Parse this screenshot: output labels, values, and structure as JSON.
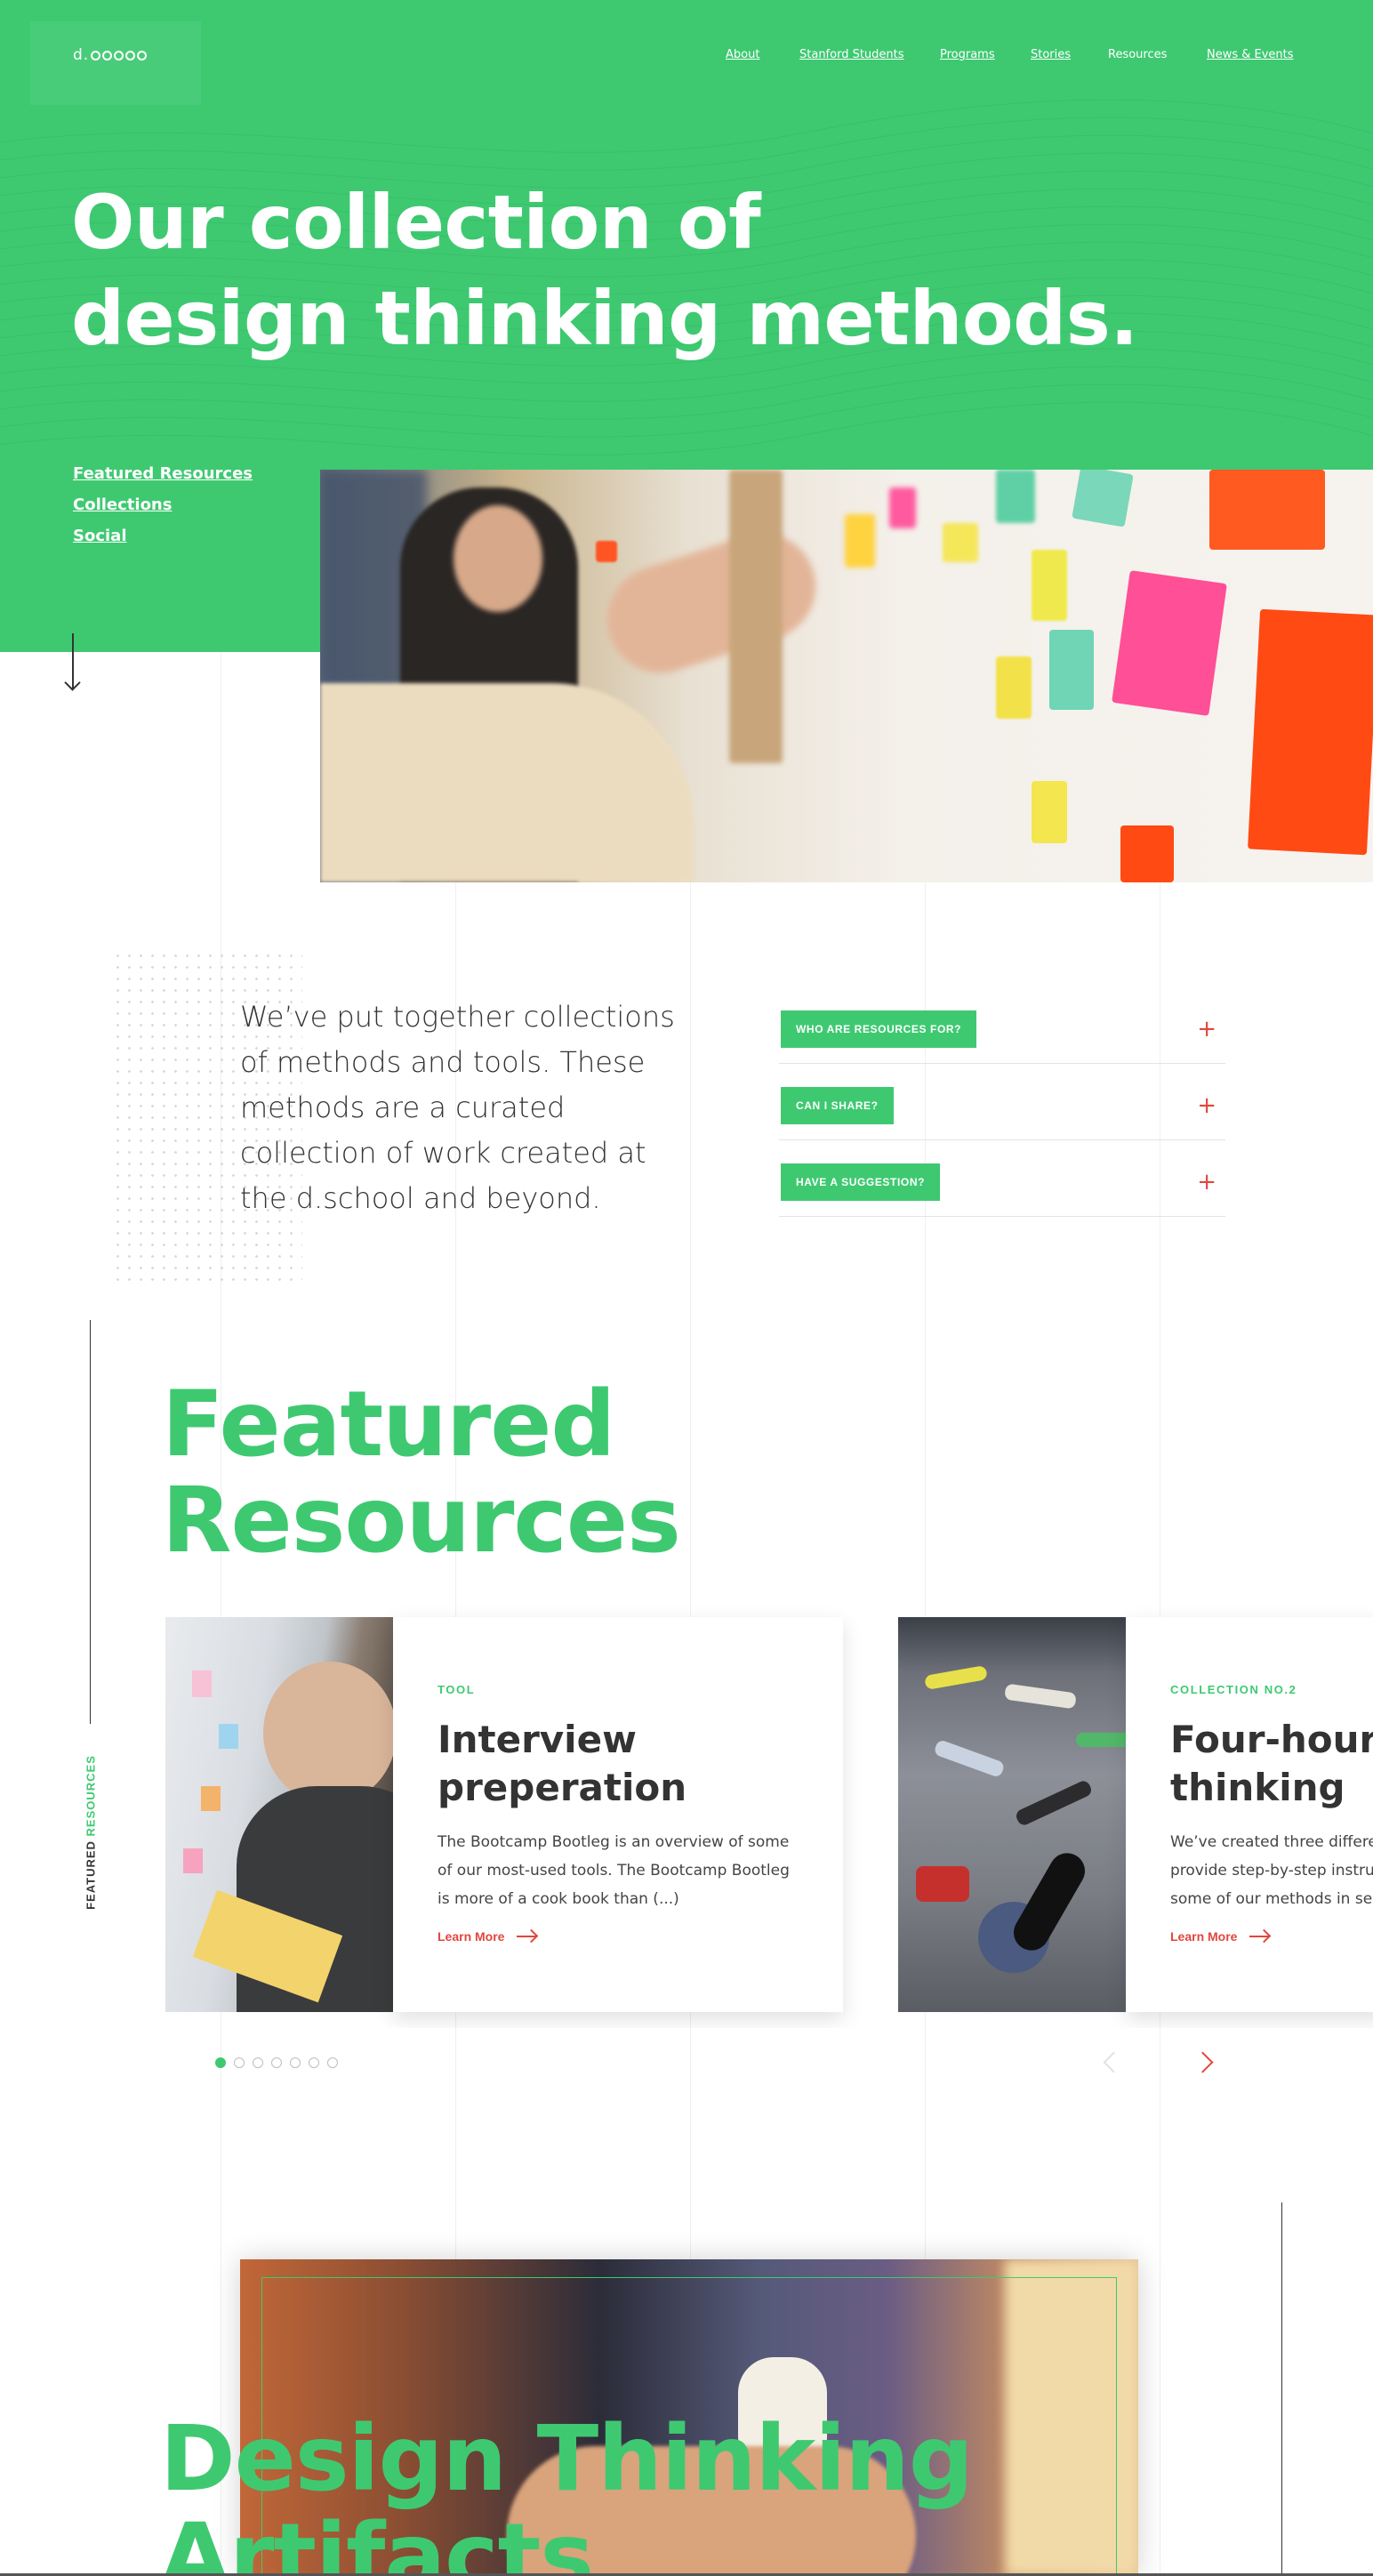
{
  "logo": {
    "text": "d."
  },
  "nav": {
    "about": "About",
    "stanford_students": "Stanford Students",
    "programs": "Programs",
    "stories": "Stories",
    "resources": "Resources",
    "news_events": "News & Events"
  },
  "hero": {
    "title_line1": "Our collection of",
    "title_line2": "design thinking methods.",
    "links": [
      "Featured Resources",
      "Collections",
      "Social"
    ]
  },
  "intro": {
    "text": "We’ve put together collections of methods and tools. These methods are a curated collection of work created at the d.school and beyond."
  },
  "faq": [
    {
      "label": "WHO ARE RESOURCES FOR?",
      "icon": "plus-icon"
    },
    {
      "label": "CAN I SHARE?",
      "icon": "plus-icon"
    },
    {
      "label": "HAVE A SUGGESTION?",
      "icon": "plus-icon"
    }
  ],
  "featured": {
    "side_label_a": "FEATURED",
    "side_label_b": "RESOURCES",
    "title_line1": "Featured",
    "title_line2": "Resources",
    "cards": [
      {
        "eyebrow": "TOOL",
        "title": "Interview preperation",
        "desc": "The Bootcamp Bootleg is an overview of some of our most-used tools. The Bootcamp Bootleg is more of a cook book than (...)",
        "link": "Learn More"
      },
      {
        "eyebrow": "COLLECTION NO.2",
        "title": "Four-hour design thinking",
        "desc": "We’ve created three different collections that provide step-by-step instructions for using some of our methods in sequence",
        "link": "Learn More"
      }
    ],
    "pager_count": 7,
    "pager_active": 0
  },
  "artifacts": {
    "title_line1": "Design Thinking",
    "title_line2": "Artifacts"
  },
  "colors": {
    "brand_green": "#3ec971",
    "accent_red": "#e2463c",
    "text_dark": "#333333"
  }
}
